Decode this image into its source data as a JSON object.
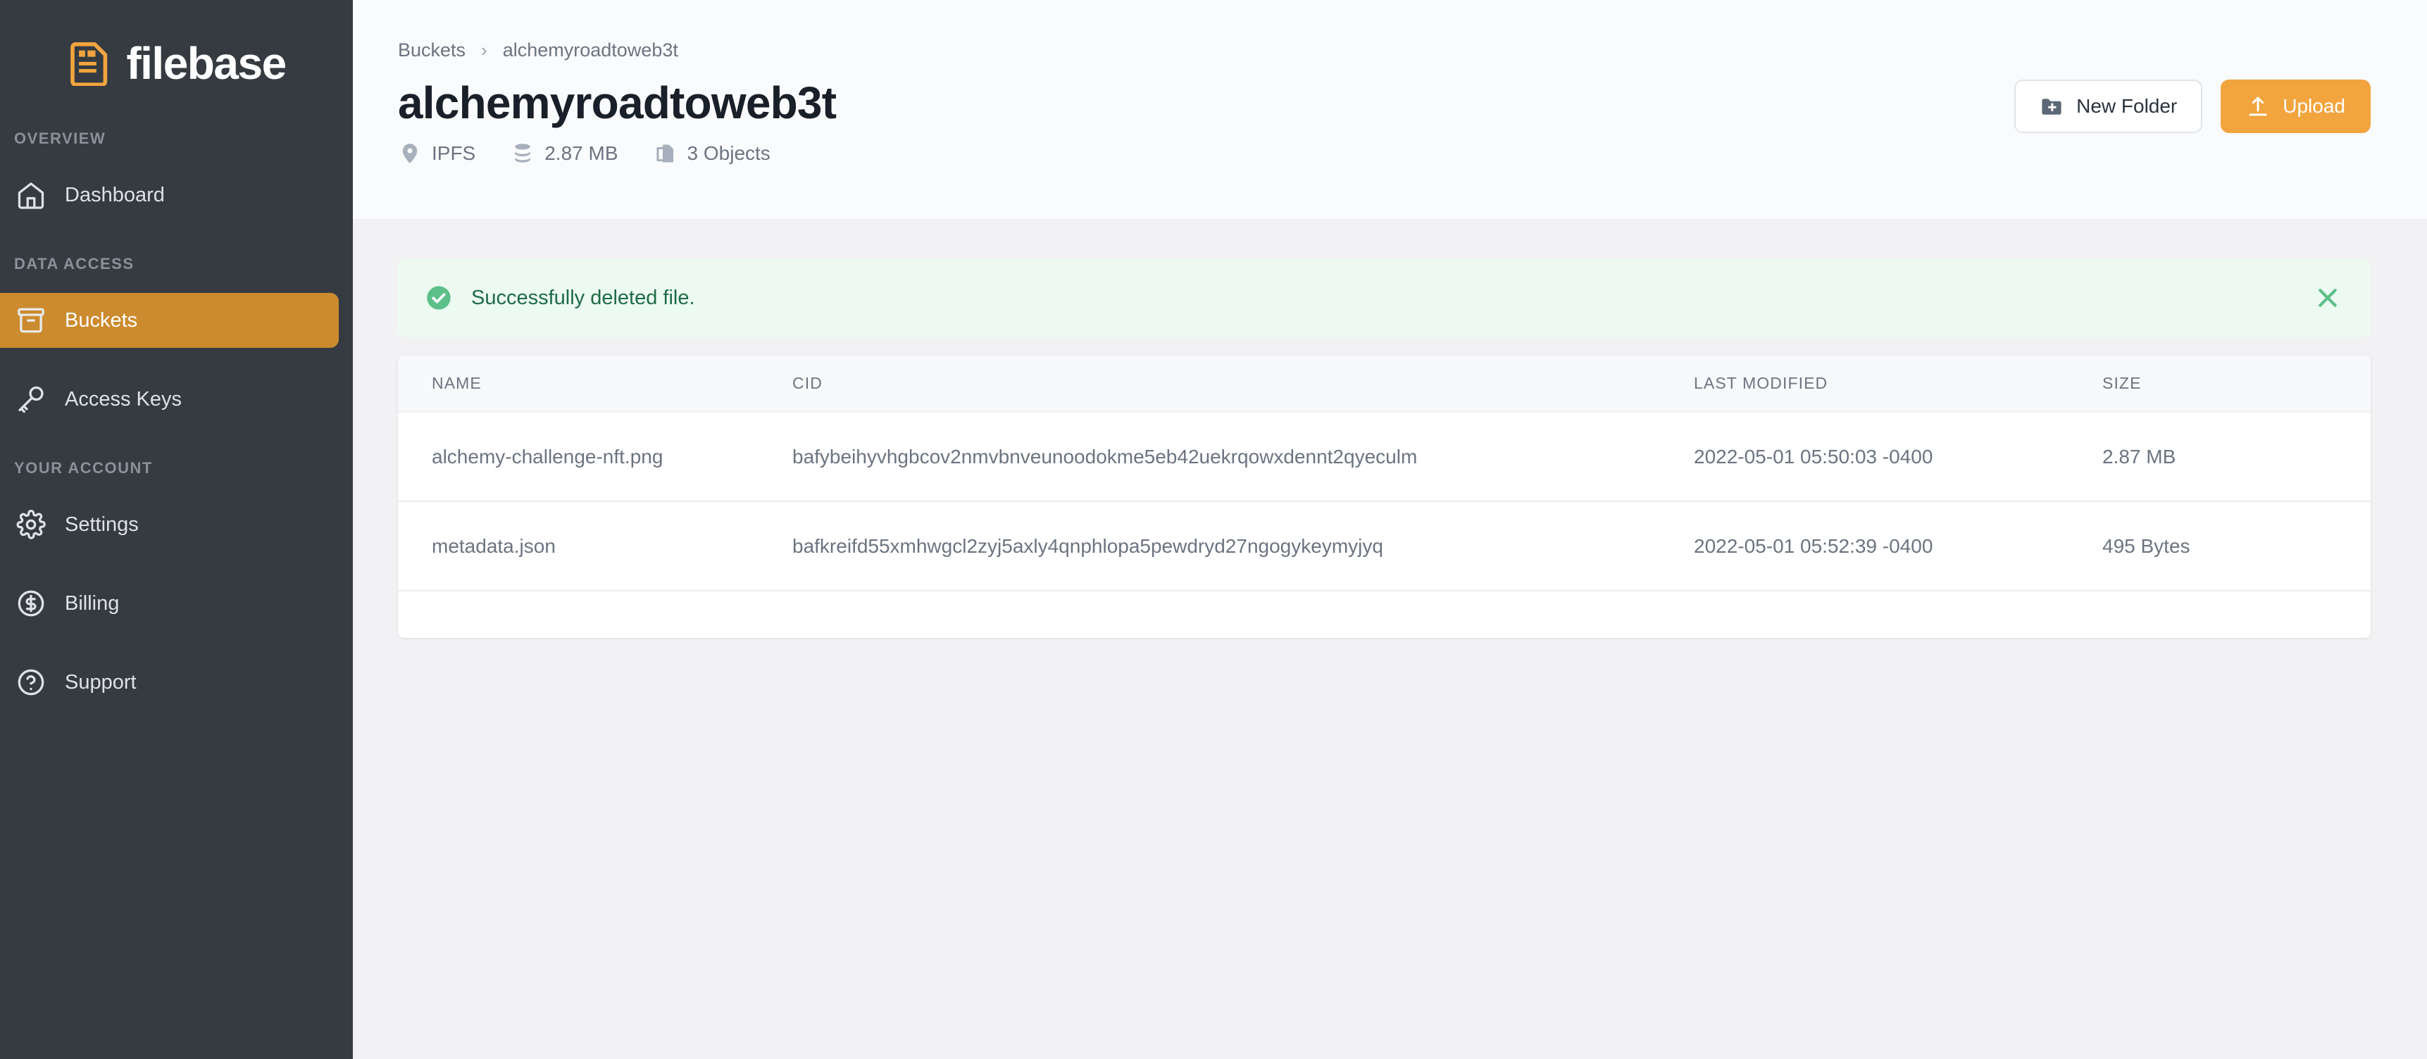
{
  "brand": {
    "name": "filebase",
    "logo_icon": "file-document-icon",
    "accent_color": "#f2a43e",
    "sidebar_color": "#353b40",
    "active_item_color": "#cc8b2e"
  },
  "sidebar": {
    "sections": [
      {
        "title": "OVERVIEW",
        "items": [
          {
            "label": "Dashboard",
            "icon": "home-icon",
            "active": false
          }
        ]
      },
      {
        "title": "DATA ACCESS",
        "items": [
          {
            "label": "Buckets",
            "icon": "archive-box-icon",
            "active": true
          },
          {
            "label": "Access Keys",
            "icon": "key-icon",
            "active": false
          }
        ]
      },
      {
        "title": "YOUR ACCOUNT",
        "items": [
          {
            "label": "Settings",
            "icon": "gear-icon",
            "active": false
          },
          {
            "label": "Billing",
            "icon": "dollar-circle-icon",
            "active": false
          },
          {
            "label": "Support",
            "icon": "question-circle-icon",
            "active": false
          }
        ]
      }
    ]
  },
  "header": {
    "breadcrumb": [
      {
        "label": "Buckets"
      },
      {
        "label": "alchemyroadtoweb3t"
      }
    ],
    "breadcrumb_separator": "›",
    "title": "alchemyroadtoweb3t",
    "meta": [
      {
        "label": "IPFS",
        "icon": "location-pin-icon"
      },
      {
        "label": "2.87 MB",
        "icon": "database-icon"
      },
      {
        "label": "3 Objects",
        "icon": "copy-documents-icon"
      }
    ],
    "actions": {
      "new_folder_label": "New Folder",
      "new_folder_icon": "folder-plus-icon",
      "upload_label": "Upload",
      "upload_icon": "upload-arrow-icon"
    }
  },
  "alert": {
    "message": "Successfully deleted file.",
    "icon": "check-circle-icon",
    "close_icon": "close-icon",
    "background_color": "#ecfaf1",
    "text_color": "#1e6b45",
    "accent_color": "#5cbf8a"
  },
  "table": {
    "columns": [
      "NAME",
      "CID",
      "LAST MODIFIED",
      "SIZE"
    ],
    "row_menu_icon": "kebab-menu-icon",
    "rows": [
      {
        "name": "alchemy-challenge-nft.png",
        "cid": "bafybeihyvhgbcov2nmvbnveunoodokme5eb42uekrqowxdennt2qyeculm",
        "last_modified": "2022-05-01 05:50:03 -0400",
        "size": "2.87 MB"
      },
      {
        "name": "metadata.json",
        "cid": "bafkreifd55xmhwgcl2zyj5axly4qnphlopa5pewdryd27ngogykeymyjyq",
        "last_modified": "2022-05-01 05:52:39 -0400",
        "size": "495 Bytes"
      }
    ]
  }
}
